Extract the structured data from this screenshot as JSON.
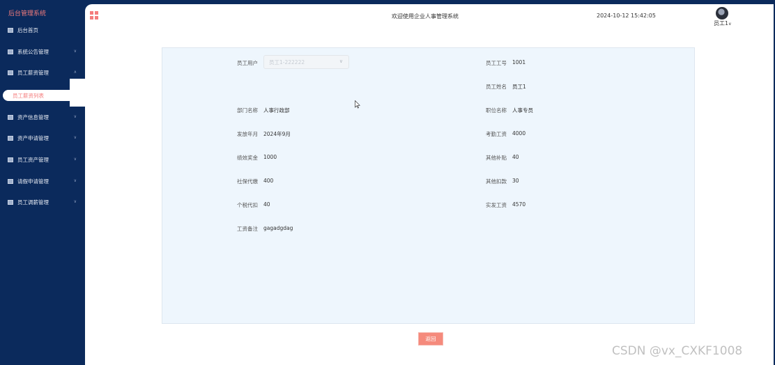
{
  "sidebar": {
    "brand": "后台管理系统",
    "items": [
      {
        "label": "后台首页",
        "chevron": ""
      },
      {
        "label": "系统公告管理",
        "chevron": "∨"
      },
      {
        "label": "员工薪资管理",
        "chevron": "∧"
      },
      {
        "label": "资产信息管理",
        "chevron": "∨"
      },
      {
        "label": "资产申请管理",
        "chevron": "∨"
      },
      {
        "label": "员工资产管理",
        "chevron": "∨"
      },
      {
        "label": "请假申请管理",
        "chevron": "∨"
      },
      {
        "label": "员工调薪管理",
        "chevron": "∨"
      }
    ],
    "active_sub": "员工薪资列表"
  },
  "header": {
    "welcome": "欢迎使用企业人事管理系统",
    "datetime": "2024-10-12 15:42:05",
    "user_label": "员工1",
    "user_chevron": "∨"
  },
  "form": {
    "employee_user": {
      "label": "员工用户",
      "placeholder": "员工1-222222"
    },
    "employee_no": {
      "label": "员工工号",
      "value": "1001"
    },
    "employee_name": {
      "label": "员工姓名",
      "value": "员工1"
    },
    "department": {
      "label": "部门名称",
      "value": "人事行政部"
    },
    "position": {
      "label": "职位名称",
      "value": "人事专员"
    },
    "pay_month": {
      "label": "发放年月",
      "value": "2024年9月"
    },
    "attendance_pay": {
      "label": "考勤工资",
      "value": "4000"
    },
    "performance_bonus": {
      "label": "绩效奖金",
      "value": "1000"
    },
    "other_allowance": {
      "label": "其他补贴",
      "value": "40"
    },
    "social_security": {
      "label": "社保代缴",
      "value": "400"
    },
    "other_deduction": {
      "label": "其他扣款",
      "value": "30"
    },
    "income_tax": {
      "label": "个税代扣",
      "value": "40"
    },
    "net_pay": {
      "label": "实发工资",
      "value": "4570"
    },
    "remark": {
      "label": "工资备注",
      "value": "gagadgdag"
    }
  },
  "actions": {
    "back_label": "返回"
  },
  "watermark": "CSDN @vx_CXKF1008"
}
